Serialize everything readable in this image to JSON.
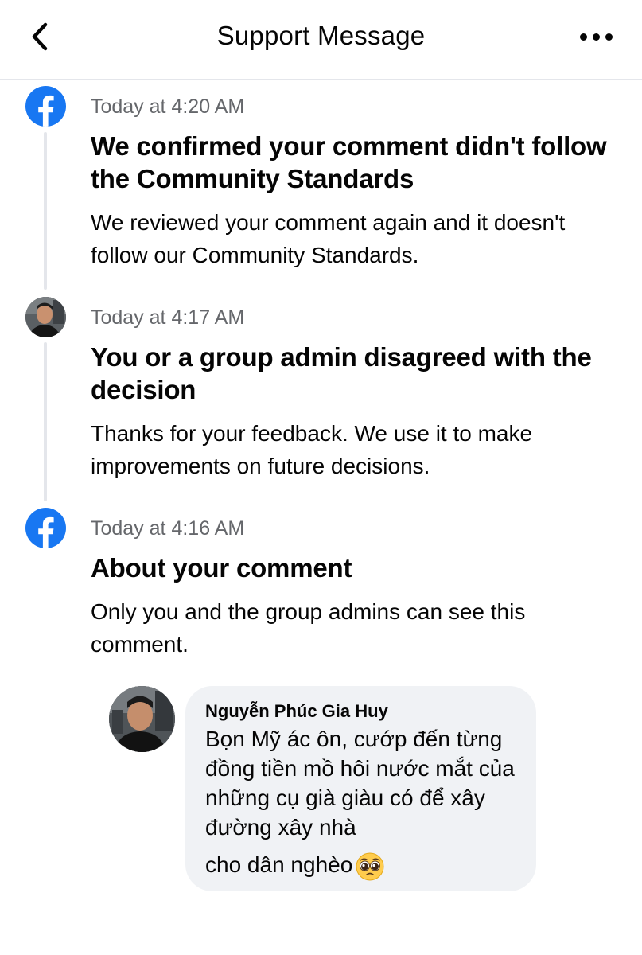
{
  "header": {
    "title": "Support Message",
    "back_icon": "chevron-left-icon",
    "more_icon": "more-horizontal-icon"
  },
  "timeline": [
    {
      "avatar": "facebook-logo-icon",
      "time": "Today at 4:20 AM",
      "title": "We confirmed your comment didn't follow the Community Standards",
      "body": "We reviewed your comment again and it doesn't follow our Community Standards."
    },
    {
      "avatar": "user-avatar",
      "time": "Today at 4:17 AM",
      "title": "You or a group admin disagreed with the decision",
      "body": "Thanks for your feedback. We use it to make improvements on future decisions."
    },
    {
      "avatar": "facebook-logo-icon",
      "time": "Today at 4:16 AM",
      "title": "About your comment",
      "body": "Only you and the group admins can see this comment."
    }
  ],
  "comment": {
    "author": "Nguyễn Phúc Gia Huy",
    "text": "Bọn Mỹ ác ôn, cướp đến từng đồng tiền mồ hôi nước mắt của những cụ già giàu có để xây đường xây nhà",
    "text_last": "cho dân nghèo",
    "emoji": "pleading-face-emoji"
  },
  "colors": {
    "facebook_blue": "#1877f2",
    "secondary_text": "#65676b",
    "bubble_bg": "#f0f2f5",
    "divider": "#e4e6eb"
  }
}
